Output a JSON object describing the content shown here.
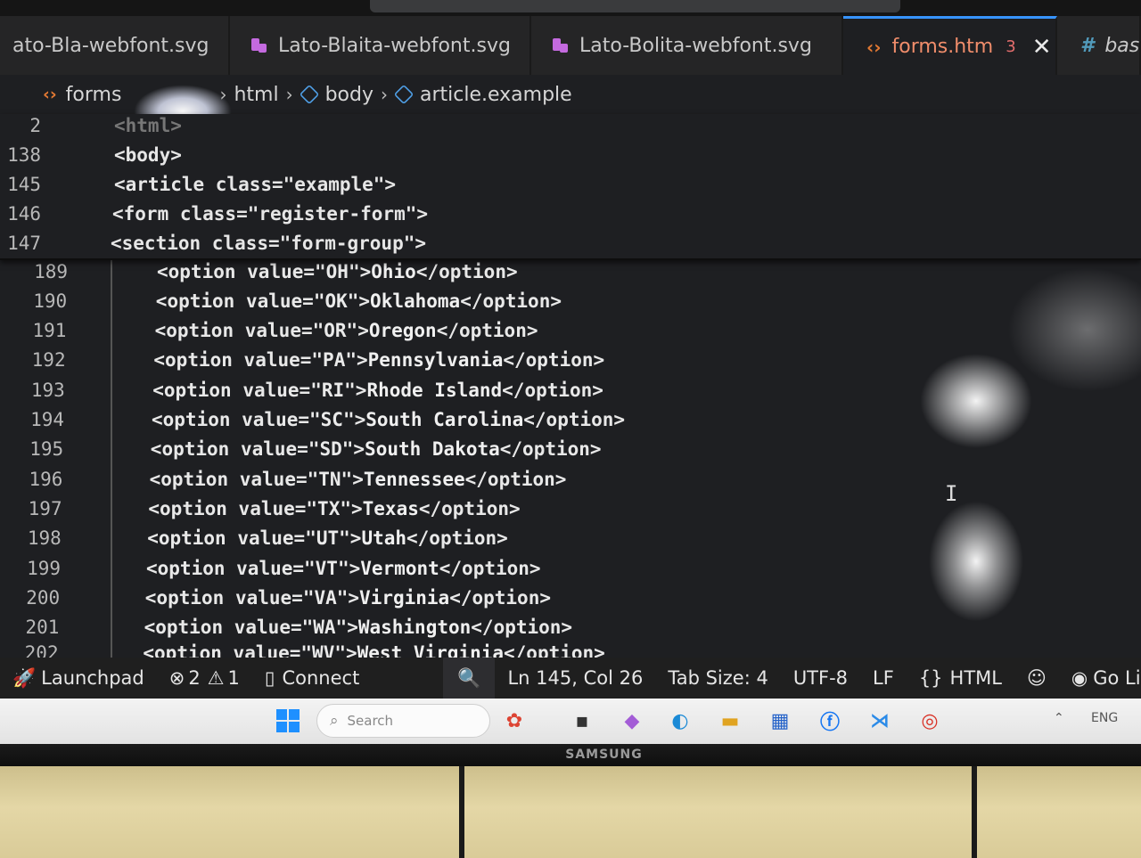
{
  "tabs": [
    {
      "label": "ato-Bla-webfont.svg",
      "type": "svg",
      "active": false
    },
    {
      "label": "Lato-Blaita-webfont.svg",
      "type": "svg",
      "active": false
    },
    {
      "label": "Lato-Bolita-webfont.svg",
      "type": "svg",
      "active": false
    },
    {
      "label": "forms.htm",
      "type": "html",
      "active": true,
      "problems": "3"
    },
    {
      "label": "bas",
      "type": "css",
      "active": false
    }
  ],
  "breadcrumb": {
    "items": [
      "forms",
      "html",
      "body",
      "article.example"
    ]
  },
  "sticky_lines": [
    {
      "n": "2",
      "code": "<html>"
    },
    {
      "n": "138",
      "code": "<body>"
    },
    {
      "n": "145",
      "code": "<article class=\"example\">"
    },
    {
      "n": "146",
      "code": "<form class=\"register-form\">"
    },
    {
      "n": "147",
      "code": "<section class=\"form-group\">"
    }
  ],
  "code_lines": [
    {
      "n": "189",
      "value": "OH",
      "label": "Ohio"
    },
    {
      "n": "190",
      "value": "OK",
      "label": "Oklahoma"
    },
    {
      "n": "191",
      "value": "OR",
      "label": "Oregon"
    },
    {
      "n": "192",
      "value": "PA",
      "label": "Pennsylvania"
    },
    {
      "n": "193",
      "value": "RI",
      "label": "Rhode Island"
    },
    {
      "n": "194",
      "value": "SC",
      "label": "South Carolina"
    },
    {
      "n": "195",
      "value": "SD",
      "label": "South Dakota"
    },
    {
      "n": "196",
      "value": "TN",
      "label": "Tennessee"
    },
    {
      "n": "197",
      "value": "TX",
      "label": "Texas"
    },
    {
      "n": "198",
      "value": "UT",
      "label": "Utah"
    },
    {
      "n": "199",
      "value": "VT",
      "label": "Vermont"
    },
    {
      "n": "200",
      "value": "VA",
      "label": "Virginia"
    },
    {
      "n": "201",
      "value": "WA",
      "label": "Washington"
    },
    {
      "n": "202",
      "value": "WV",
      "label": "West Virginia"
    }
  ],
  "status": {
    "launchpad": "Launchpad",
    "errors": "2",
    "warnings": "1",
    "connect": "Connect",
    "position": "Ln 145, Col 26",
    "tab_size": "Tab Size: 4",
    "encoding": "UTF-8",
    "eol": "LF",
    "language": "HTML",
    "golive": "Go Live"
  },
  "taskbar": {
    "search_placeholder": "Search",
    "tray_lang": "ENG"
  },
  "monitor_brand": "SAMSUNG",
  "colors": {
    "editor_bg": "#1e1f22",
    "active_tab_text": "#f08d6b",
    "string": "#9cc3ff",
    "html_icon": "#e37933"
  }
}
